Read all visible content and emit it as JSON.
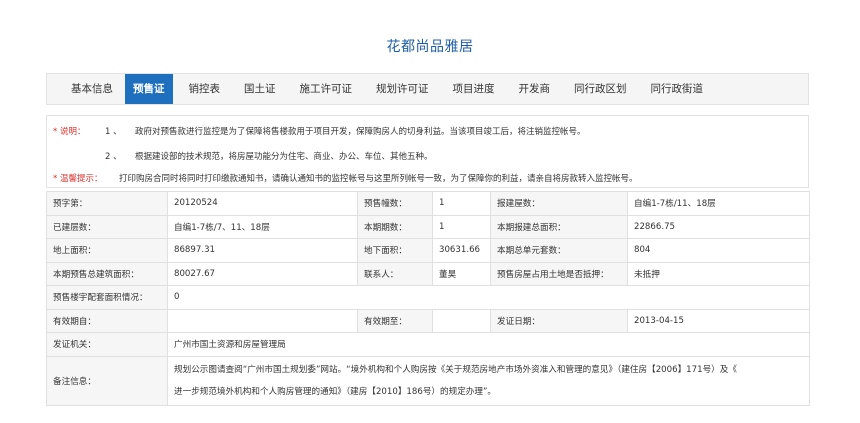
{
  "page": {
    "title": "花都尚品雅居"
  },
  "tabs": [
    {
      "label": "基本信息",
      "active": false
    },
    {
      "label": "预售证",
      "active": true
    },
    {
      "label": "销控表",
      "active": false
    },
    {
      "label": "国土证",
      "active": false
    },
    {
      "label": "施工许可证",
      "active": false
    },
    {
      "label": "规划许可证",
      "active": false
    },
    {
      "label": "项目进度",
      "active": false
    },
    {
      "label": "开发商",
      "active": false
    },
    {
      "label": "同行政区划",
      "active": false
    },
    {
      "label": "同行政街道",
      "active": false
    }
  ],
  "notes": {
    "note_prefix": "* 说明：",
    "item1_num": "1 、",
    "item1_text": "政府对预售款进行监控是为了保障将售楼款用于项目开发，保障购房人的切身利益。当该项目竣工后，将注销监控帐号。",
    "item2_num": "2 、",
    "item2_text": "根据建设部的技术规范，将房屋功能分为住宅、商业、办公、车位、其他五种。",
    "tip_prefix": "* 温馨提示：",
    "tip_text": "打印购房合同时将同时打印缴款通知书，请确认通知书的监控帐号与这里所列帐号一致，为了保障你的利益，请亲自将房款转入监控帐号。"
  },
  "info": {
    "r1": {
      "l1": "预字第：",
      "v1": "20120524",
      "l2": "预售幢数：",
      "v2": "1",
      "l3": "报建屋数：",
      "v3": "自编1-7栋/11、18层"
    },
    "r2": {
      "l1": "已建层数：",
      "v1": "自编1-7栋/7、11、18层",
      "l2": "本期期数：",
      "v2": "1",
      "l3": "本期报建总面积：",
      "v3": "22866.75"
    },
    "r3": {
      "l1": "地上面积：",
      "v1": "86897.31",
      "l2": "地下面积：",
      "v2": "30631.66",
      "l3": "本期总单元套数：",
      "v3": "804"
    },
    "r4": {
      "l1": "本期预售总建筑面积：",
      "v1": "80027.67",
      "l2": "联系人：",
      "v2": "董昊",
      "l3": "预售房屋占用土地是否抵押：",
      "v3": "未抵押"
    },
    "r5": {
      "l1": "预售楼宇配套面积情况：",
      "v1": "0"
    },
    "r6": {
      "l1": "有效期自：",
      "v1": "",
      "l2": "有效期至：",
      "v2": "",
      "l3": "发证日期：",
      "v3": "2013-04-15"
    },
    "r7": {
      "l1": "发证机关：",
      "v1": "广州市国土资源和房屋管理局"
    },
    "r8": {
      "l1": "备注信息：",
      "line1": "规划公示图请查阅“广州市国土规划委”网站。“境外机构和个人购房按《关于规范房地产市场外资准入和管理的意见》（建住房【2006】171号）及《",
      "line2": "进一步规范境外机构和个人购房管理的通知》（建房【2010】186号）的规定办理”。"
    }
  },
  "colors": {
    "title": "#1f5fa8",
    "active_tab": "#1f6fbf",
    "note_red": "#d9302b"
  }
}
